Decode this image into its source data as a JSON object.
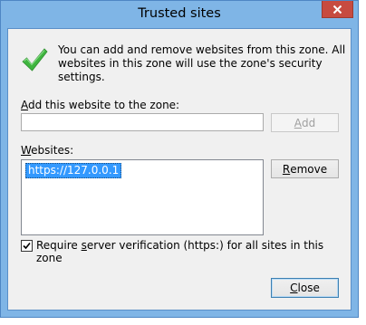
{
  "window": {
    "title": "Trusted sites",
    "colors": {
      "frame": "#7fb5e6",
      "close_button": "#c74b40",
      "accent": "#3399ff",
      "check": "#3fb53f"
    }
  },
  "info": {
    "icon": "green-check-icon",
    "text": "You can add and remove websites from this zone. All websites in this zone will use the zone's security settings."
  },
  "add_site": {
    "label_mnemonic": "A",
    "label_rest": "dd this website to the zone:",
    "value": "",
    "button_mnemonic": "A",
    "button_rest": "dd",
    "button_enabled": false
  },
  "websites": {
    "label_mnemonic": "W",
    "label_rest": "ebsites:",
    "items": [
      "https://127.0.0.1"
    ],
    "selected_index": 0,
    "remove_mnemonic": "R",
    "remove_rest": "emove"
  },
  "verification": {
    "checked": true,
    "label_mnemonic": "s",
    "label_before": "Require ",
    "label_after": "erver verification (https:) for all sites in this zone"
  },
  "footer": {
    "close_mnemonic": "C",
    "close_rest": "lose"
  }
}
